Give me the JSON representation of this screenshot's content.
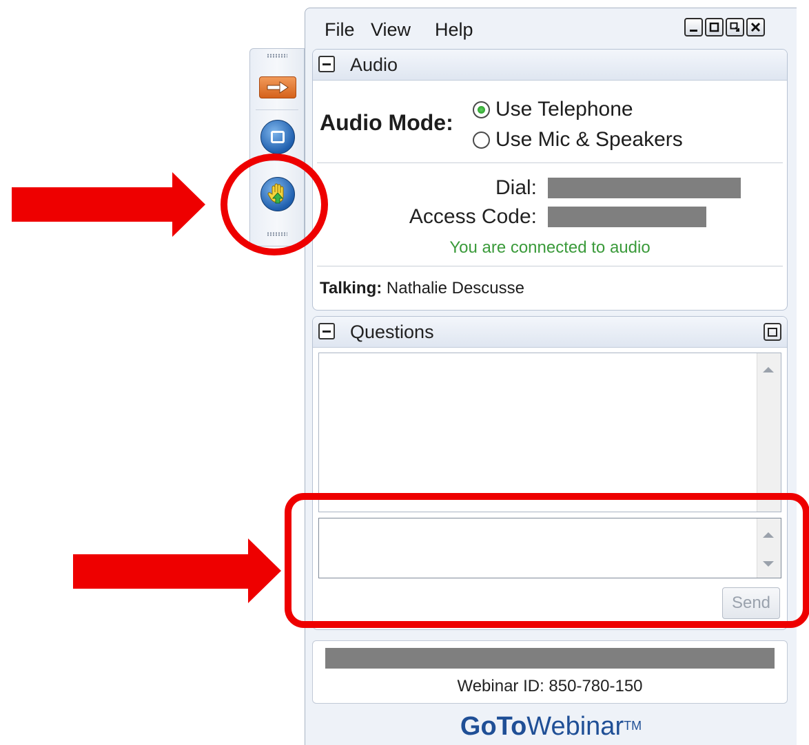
{
  "window": {
    "menu": [
      "File",
      "View",
      "Help"
    ],
    "controls": [
      "minimize",
      "maximize",
      "popout",
      "close"
    ]
  },
  "side_toolbar": {
    "buttons": [
      {
        "name": "collapse-arrow",
        "icon": "arrow-right-icon",
        "color": "#e06a21"
      },
      {
        "name": "show-screen",
        "icon": "window-icon",
        "color": "#1f5fae"
      },
      {
        "name": "raise-hand",
        "icon": "raise-hand-icon",
        "color": "#1f5fae"
      }
    ]
  },
  "audio": {
    "title": "Audio",
    "mode_label": "Audio Mode:",
    "options": [
      {
        "label": "Use Telephone",
        "selected": true
      },
      {
        "label": "Use Mic & Speakers",
        "selected": false
      }
    ],
    "dial_label": "Dial:",
    "access_code_label": "Access Code:",
    "status": "You are connected to audio",
    "status_color": "#3a9a3a",
    "talking_label": "Talking:",
    "talking_name": "Nathalie Descusse"
  },
  "questions": {
    "title": "Questions",
    "send_label": "Send",
    "input_value": ""
  },
  "footer": {
    "webinar_id": "Webinar ID: 850-780-150",
    "brand_bold": "GoTo",
    "brand_rest": "Webinar",
    "brand_tm": "TM",
    "brand_color": "#1f4f96"
  },
  "annotations": {
    "color": "#ee0000"
  }
}
